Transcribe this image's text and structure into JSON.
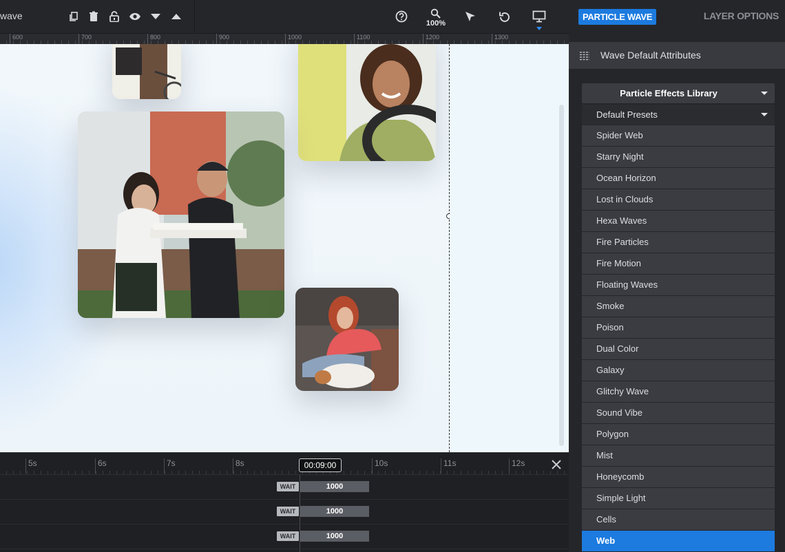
{
  "toolbar": {
    "doc_name": "wave",
    "zoom_label": "100%",
    "icons": [
      "duplicate-icon",
      "trash-icon",
      "lock-icon",
      "eye-icon",
      "arrow-down-icon",
      "arrow-up-icon",
      "help-icon",
      "zoom-icon",
      "pointer-icon",
      "undo-icon",
      "desktop-icon"
    ]
  },
  "ruler": {
    "labels": [
      "600",
      "700",
      "800",
      "900",
      "1000",
      "1100",
      "1200",
      "1300"
    ]
  },
  "timeline": {
    "labels": [
      "5s",
      "6s",
      "7s",
      "8s",
      "10s",
      "11s",
      "12s"
    ],
    "current_time": "00:09:00",
    "rows": [
      {
        "tag": "WAIT",
        "value": "1000"
      },
      {
        "tag": "WAIT",
        "value": "1000"
      },
      {
        "tag": "WAIT",
        "value": "1000"
      }
    ]
  },
  "panel": {
    "tab_active": "PARTICLE WAVE",
    "tab_inactive": "LAYER OPTIONS",
    "header_title": "Wave Default Attributes",
    "library_label": "Particle Effects Library",
    "presets_label": "Default Presets",
    "presets": [
      "Spider Web",
      "Starry Night",
      "Ocean Horizon",
      "Lost in Clouds",
      "Hexa Waves",
      "Fire Particles",
      "Fire Motion",
      "Floating Waves",
      "Smoke",
      "Poison",
      "Dual Color",
      "Galaxy",
      "Glitchy Wave",
      "Sound Vibe",
      "Polygon",
      "Mist",
      "Honeycomb",
      "Simple Light",
      "Cells",
      "Web"
    ],
    "selected_preset": "Web"
  },
  "colors": {
    "accent": "#1d7bdf",
    "panel_bg": "#25262a",
    "item_bg": "#3a3c41"
  }
}
